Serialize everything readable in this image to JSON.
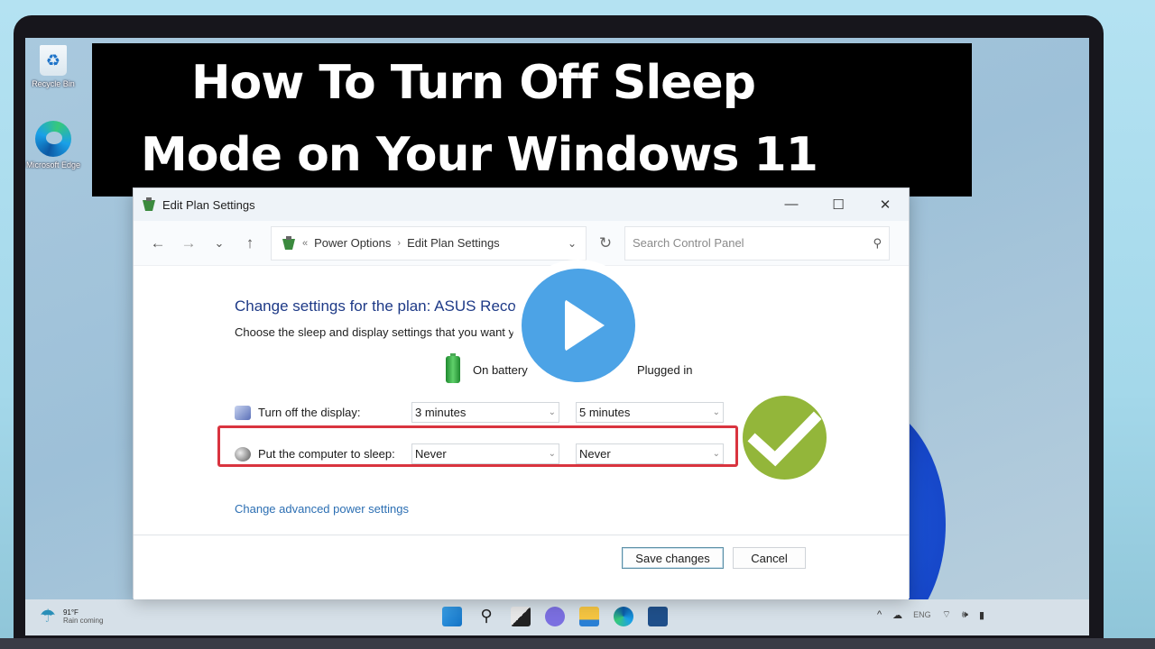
{
  "banner": {
    "line1": "How To Turn Off Sleep",
    "line2": "Mode on Your Windows 11"
  },
  "desktop": {
    "icons": [
      {
        "label": "Recycle Bin",
        "icon": "recycle-bin-icon"
      },
      {
        "label": "Microsoft Edge",
        "icon": "edge-icon"
      }
    ]
  },
  "window": {
    "title": "Edit Plan Settings",
    "controls": {
      "minimize": "—",
      "maximize": "☐",
      "close": "✕"
    },
    "nav": {
      "back": "←",
      "forward": "→",
      "recent": "⌄",
      "up": "↑",
      "refresh": "↻"
    },
    "breadcrumb": {
      "overflow": "«",
      "items": [
        "Power Options",
        "Edit Plan Settings"
      ],
      "separator": "›",
      "dropdown": "⌄"
    },
    "search": {
      "placeholder": "Search Control Panel",
      "value": "",
      "icon": "⚲"
    },
    "heading": "Change settings for the plan: ASUS Recor",
    "subheading": "Choose the sleep and display settings that you want y",
    "columns": {
      "battery": "On battery",
      "plugged": "Plugged in"
    },
    "settings": [
      {
        "label": "Turn off the display:",
        "on_battery": "3 minutes",
        "plugged_in": "5 minutes"
      },
      {
        "label": "Put the computer to sleep:",
        "on_battery": "Never",
        "plugged_in": "Never"
      }
    ],
    "advanced_link": "Change advanced power settings",
    "buttons": {
      "save": "Save changes",
      "cancel": "Cancel"
    }
  },
  "overlay": {
    "play_icon": "play-button",
    "check_icon": "checkmark",
    "highlight_color": "#d9343f",
    "check_color": "#93b63a",
    "play_color": "#4ca3e6"
  },
  "taskbar": {
    "weather": {
      "temp": "91°F",
      "status": "Rain coming"
    },
    "apps": [
      "start",
      "search",
      "task-view",
      "chat",
      "file-explorer",
      "edge",
      "store"
    ],
    "tray": {
      "chevron": "^",
      "language": "ENG",
      "wifi": "wifi",
      "volume": "volume",
      "battery": "battery"
    }
  }
}
